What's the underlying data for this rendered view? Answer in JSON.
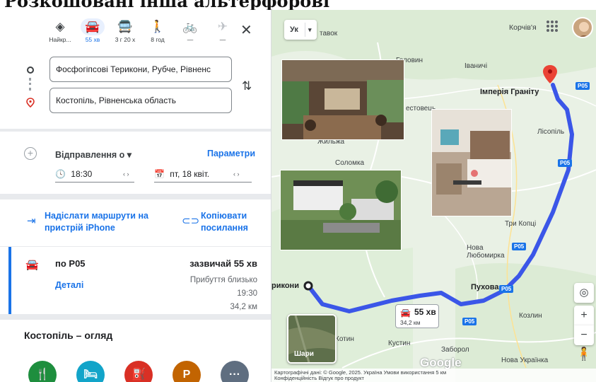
{
  "caption": "Розкошовані інша альтерфоровї",
  "modes": [
    {
      "icon": "best-route-icon",
      "label": "Найкр..."
    },
    {
      "icon": "car-icon",
      "label": "55 хв"
    },
    {
      "icon": "transit-icon",
      "label": "3 г 20 х"
    },
    {
      "icon": "walk-icon",
      "label": "8 год"
    },
    {
      "icon": "bike-icon",
      "label": "—"
    },
    {
      "icon": "flight-icon",
      "label": "—"
    }
  ],
  "origin": "Фосфогіпсові Терикони, Рубче, Рівненс",
  "destination": "Костопіль, Рівненська область",
  "departure": {
    "label": "Відправлення о",
    "params": "Параметри",
    "time": "18:30",
    "date": "пт, 18 квіт."
  },
  "share": {
    "send": "Надіслати маршрути на пристрій iPhone",
    "copy": "Копіювати посилання"
  },
  "route": {
    "via": "по P05",
    "usually": "зазвичай 55 хв",
    "details": "Деталі",
    "arrival_label": "Прибуття близько",
    "arrival_time": "19:30",
    "distance": "34,2 км"
  },
  "overview_title": "Костопіль – огляд",
  "categories": [
    {
      "icon": "restaurant-icon",
      "glyph": "🍴",
      "color": "#1e8e3e"
    },
    {
      "icon": "hotel-icon",
      "glyph": "🛏",
      "color": "#12a4c9"
    },
    {
      "icon": "gas-icon",
      "glyph": "⛽",
      "color": "#d93025"
    },
    {
      "icon": "parking-icon",
      "glyph": "P",
      "color": "#c26401"
    },
    {
      "icon": "more-icon",
      "glyph": "···",
      "color": "#5f6e80"
    }
  ],
  "map": {
    "lang": "Ук",
    "account_place": "Корчів'я",
    "labels": {
      "tavok": "тавок",
      "golovyn": "Головин",
      "ivanychi": "Іваничі",
      "imperia": "Імперія Граніту",
      "rozhist": "естовець",
      "zhylzha": "Жильжа",
      "solomka": "Соломка",
      "lisopil": "Лісопіль",
      "tri_kopci": "Три Копці",
      "nova_l": "Нова Любомирка",
      "pukhova": "Пухова",
      "terykony": "рикони",
      "kozlyn": "Козлин",
      "kotyn": "Котин",
      "kustyn": "Кустин",
      "zaborol": "Заборол",
      "nova_ukr": "Нова Українка",
      "p05a": "P05",
      "p05b": "P05",
      "p05c": "P05",
      "p05d": "P05",
      "p05e": "P05"
    },
    "duration": "55 хв",
    "distance": "34,2 км",
    "satellite": "Шари",
    "google": "Google",
    "footer_line1": "Картографічні дані: © Google, 2025.   Україна   Умови використання   5 км",
    "footer_line2": "Конфіденційність   Відгук про продукт"
  },
  "colors": {
    "accent": "#1a73e8",
    "route": "#3b56e8"
  }
}
